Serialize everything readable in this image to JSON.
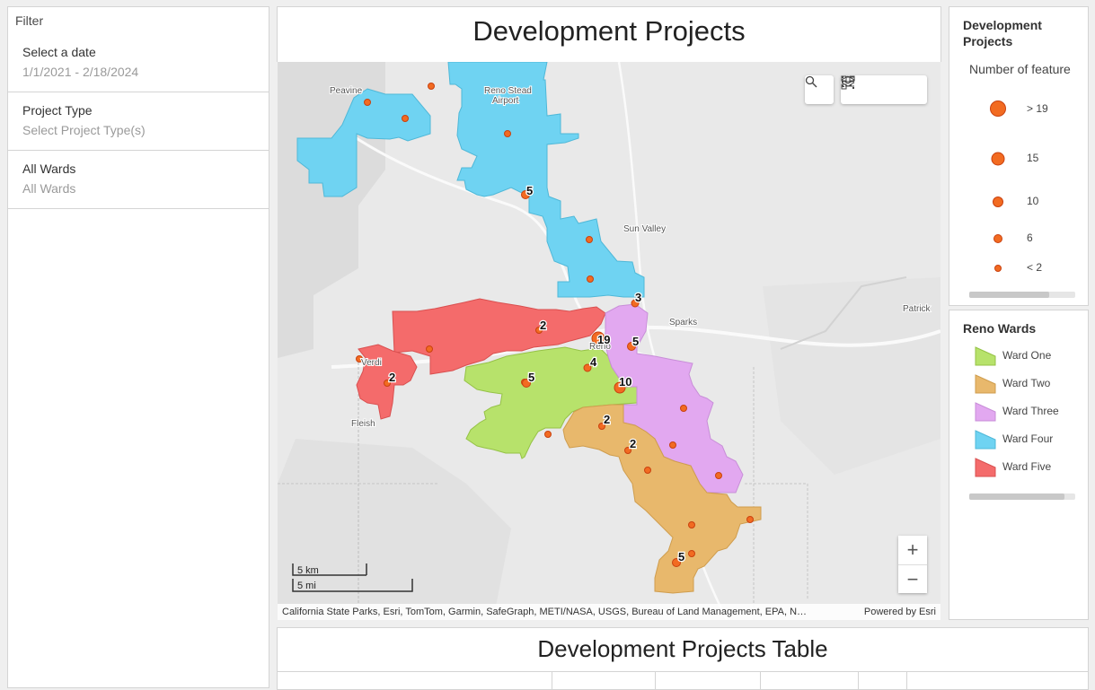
{
  "filter": {
    "title": "Filter",
    "groups": [
      {
        "label": "Select a date",
        "value": "1/1/2021 - 2/18/2024"
      },
      {
        "label": "Project Type",
        "value": "Select Project Type(s)"
      },
      {
        "label": "All Wards",
        "value": "All Wards"
      }
    ]
  },
  "header": {
    "title": "Development Projects"
  },
  "map": {
    "place_labels": [
      "Peavine",
      "Reno Stead",
      "Airport",
      "Sun Valley",
      "Sparks",
      "Patrick",
      "Reno",
      "Verdi",
      "Fleish"
    ],
    "cluster_counts": [
      "5",
      "3",
      "2",
      "19",
      "5",
      "4",
      "5",
      "2",
      "10",
      "2",
      "2",
      "5"
    ],
    "scale": {
      "km": "5 km",
      "mi": "5 mi"
    },
    "attribution": "California State Parks, Esri, TomTom, Garmin, SafeGraph, METI/NASA, USGS, Bureau of Land Management, EPA, N…",
    "powered_by": "Powered by Esri",
    "tools": [
      "search-icon",
      "list-icon",
      "layers-icon",
      "qr-code-icon"
    ],
    "zoom_in": "+",
    "zoom_out": "−"
  },
  "legend_projects": {
    "title": "Development Projects",
    "subtitle": "Number of feature",
    "sizes": [
      "> 19",
      "15",
      "10",
      "6",
      "< 2"
    ]
  },
  "legend_wards": {
    "title": "Reno Wards",
    "wards": [
      {
        "label": "Ward One",
        "color": "#b7e26b"
      },
      {
        "label": "Ward Two",
        "color": "#e8b86c"
      },
      {
        "label": "Ward Three",
        "color": "#e2a8f0"
      },
      {
        "label": "Ward Four",
        "color": "#6fd3f2"
      },
      {
        "label": "Ward Five",
        "color": "#f46b6b"
      }
    ]
  },
  "table": {
    "title": "Development Projects Table"
  }
}
